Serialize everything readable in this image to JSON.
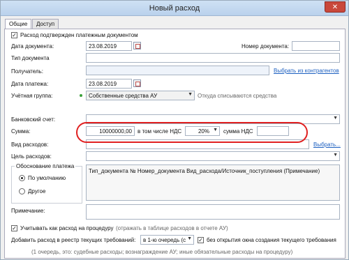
{
  "window": {
    "title": "Новый расход",
    "close": "✕"
  },
  "tabs": [
    {
      "label": "Общие"
    },
    {
      "label": "Доступ"
    }
  ],
  "confirm_checkbox": {
    "label": "Расход подтвержден платежным документом",
    "checked": true
  },
  "doc_date": {
    "label": "Дата документа:",
    "value": "23.08.2019"
  },
  "doc_number": {
    "label": "Номер документа:",
    "value": ""
  },
  "doc_type": {
    "label": "Тип документа",
    "value": ""
  },
  "recipient": {
    "label": "Получатель:",
    "value": "",
    "link": "Выбрать из контрагентов"
  },
  "pay_date": {
    "label": "Дата платежа:",
    "value": "23.08.2019"
  },
  "accounting_group": {
    "label": "Учётная группа:",
    "value": "Собственные средства АУ",
    "hint": "Откуда списываются средства"
  },
  "bank_account": {
    "label": "Банковский счет:",
    "value": ""
  },
  "sum": {
    "label": "Сумма:",
    "value": "10000000,00",
    "vat_label": "в том числе НДС",
    "vat_rate": "20%",
    "vat_sum_label": "сумма НДС",
    "vat_sum_value": ""
  },
  "expense_type": {
    "label": "Вид расходов:",
    "value": "",
    "link": "Выбрать..."
  },
  "purpose": {
    "label": "Цель расходов:",
    "value": ""
  },
  "justification": {
    "title": "Обоснование платежа",
    "option_default": "По умолчанию",
    "option_other": "Другое",
    "text": "Тип_документа № Номер_документа Вид_расхода/Источник_поступления (Примечание)"
  },
  "note": {
    "label": "Примечание:",
    "value": ""
  },
  "procedure_checkbox": {
    "label": "Учитывать как расход на процедуру",
    "hint": "(отражать в таблице расходов в отчете АУ)",
    "checked": true
  },
  "registry": {
    "label": "Добавить расход в реестр текущих требований:",
    "queue_value": "в 1-ю очередь (с",
    "no_window_label": "без открытия окна создания текущего требования",
    "no_window_checked": true,
    "note": "(1 очередь, это: судебные расходы; вознаграждение АУ; иные обязательные расходы на процедуру)"
  }
}
